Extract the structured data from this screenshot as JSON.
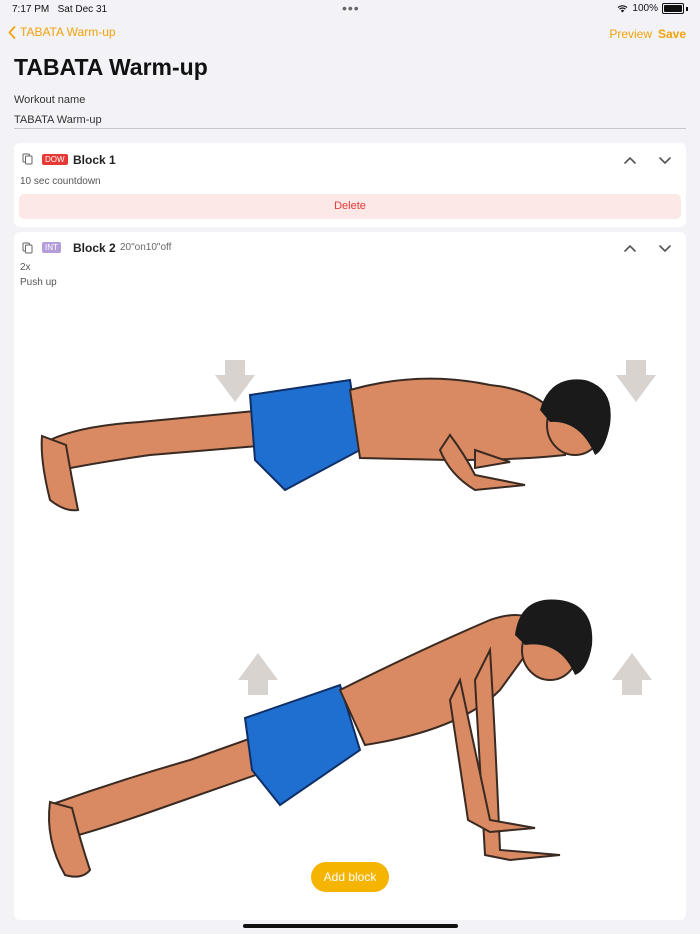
{
  "status_bar": {
    "time": "7:17 PM",
    "date": "Sat Dec 31",
    "dots": "•••",
    "battery": "100%"
  },
  "nav": {
    "back_label": "TABATA Warm-up",
    "preview_label": "Preview",
    "save_label": "Save"
  },
  "page": {
    "title": "TABATA Warm-up",
    "field_label": "Workout name",
    "field_value": "TABATA Warm-up"
  },
  "blocks": [
    {
      "tag": "DOW",
      "tag_color": "#e53935",
      "name": "Block 1",
      "subtitle": "",
      "lines": [
        "10 sec countdown"
      ],
      "delete_label": "Delete"
    },
    {
      "tag": "INT",
      "tag_color": "#b39ddb",
      "name": "Block 2",
      "subtitle": "20\"on10\"off",
      "lines": [
        "2x",
        "Push up"
      ],
      "illustration": "push-up-exercise-illustration"
    }
  ],
  "add_block_label": "Add block",
  "colors": {
    "accent": "#f0a30a",
    "add_button": "#f5b400",
    "delete_bg": "#fde8e8",
    "delete_text": "#e53935"
  }
}
